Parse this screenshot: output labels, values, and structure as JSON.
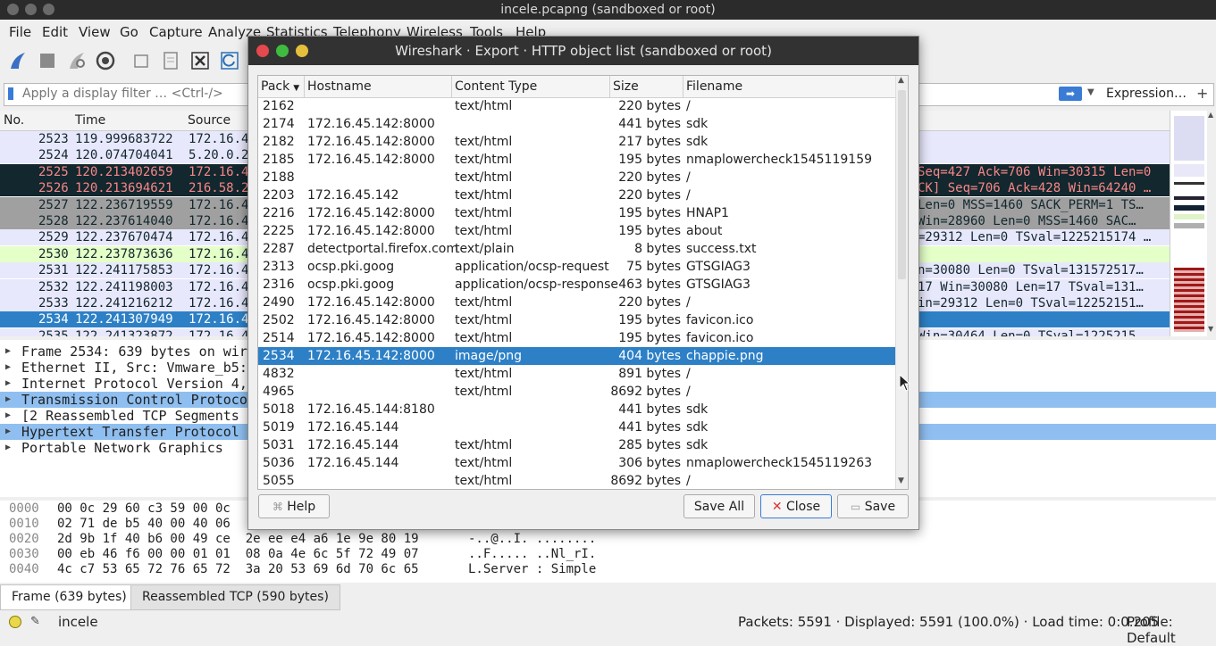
{
  "window": {
    "title": "incele.pcapng (sandboxed or root)"
  },
  "menu": [
    "File",
    "Edit",
    "View",
    "Go",
    "Capture",
    "Analyze",
    "Statistics",
    "Telephony",
    "Wireless",
    "Tools",
    "Help"
  ],
  "filter": {
    "placeholder": "Apply a display filter … <Ctrl-/>",
    "expression_label": "Expression…",
    "plus_label": "+"
  },
  "packet_list": {
    "columns": [
      "No.",
      "Time",
      "Source"
    ],
    "rows": [
      {
        "no": "2523",
        "time": "119.999683722",
        "source": "172.16.4",
        "info": "",
        "style": "lav"
      },
      {
        "no": "2524",
        "time": "120.074704041",
        "source": "5.20.0.2",
        "info": "",
        "style": "lav"
      },
      {
        "no": "2525",
        "time": "120.213402659",
        "source": "172.16.4",
        "info": "Seq=427 Ack=706 Win=30315 Len=0",
        "style": "darkred"
      },
      {
        "no": "2526",
        "time": "120.213694621",
        "source": "216.58.2",
        "info": "CK] Seq=706 Ack=428 Win=64240 …",
        "style": "darkred"
      },
      {
        "no": "2527",
        "time": "122.236719559",
        "source": "172.16.4",
        "info": "Len=0 MSS=1460 SACK_PERM=1 TS…",
        "style": "gray"
      },
      {
        "no": "2528",
        "time": "122.237614040",
        "source": "172.16.4",
        "info": " Win=28960 Len=0 MSS=1460 SAC…",
        "style": "gray"
      },
      {
        "no": "2529",
        "time": "122.237670474",
        "source": "172.16.4",
        "info": "=29312 Len=0 TSval=1225215174 …",
        "style": "lav"
      },
      {
        "no": "2530",
        "time": "122.237873636",
        "source": "172.16.4",
        "info": "",
        "style": "green"
      },
      {
        "no": "2531",
        "time": "122.241175853",
        "source": "172.16.4",
        "info": "n=30080 Len=0 TSval=131572517…",
        "style": "lav"
      },
      {
        "no": "2532",
        "time": "122.241198003",
        "source": "172.16.4",
        "info": "17 Win=30080 Len=17 TSval=131…",
        "style": "lav"
      },
      {
        "no": "2533",
        "time": "122.241216212",
        "source": "172.16.4",
        "info": "in=29312 Len=0 TSval=12252151…",
        "style": "lav"
      },
      {
        "no": "2534",
        "time": "122.241307949",
        "source": "172.16.4",
        "info": "",
        "style": "selected"
      },
      {
        "no": "2535",
        "time": "122.241323872",
        "source": "172.16.4",
        "info": "Win=30464 Len=0 TSval=1225215…",
        "style": "lav"
      }
    ]
  },
  "details": [
    {
      "text": "Frame 2534: 639 bytes on wir",
      "highlight": false
    },
    {
      "text": "Ethernet II, Src: Vmware_b5:",
      "highlight": false
    },
    {
      "text": "Internet Protocol Version 4,",
      "highlight": false
    },
    {
      "text": "Transmission Control Protoco",
      "highlight": true
    },
    {
      "text": "[2 Reassembled TCP Segments",
      "highlight": false
    },
    {
      "text": "Hypertext Transfer Protocol",
      "highlight": true
    },
    {
      "text": "Portable Network Graphics",
      "highlight": false
    }
  ],
  "bytes": [
    {
      "off": "0000",
      "hex": "00 0c 29 60 c3 59 00 0c",
      "ascii": ""
    },
    {
      "off": "0010",
      "hex": "02 71 de b5 40 00 40 06",
      "ascii": ""
    },
    {
      "off": "0020",
      "hex": "2d 9b 1f 40 b6 00 49 ce  2e ee e4 a6 1e 9e 80 19",
      "ascii": "-..@..I. ........"
    },
    {
      "off": "0030",
      "hex": "00 eb 46 f6 00 00 01 01  08 0a 4e 6c 5f 72 49 07",
      "ascii": "..F..... ..Nl_rI."
    },
    {
      "off": "0040",
      "hex": "4c c7 53 65 72 76 65 72  3a 20 53 69 6d 70 6c 65",
      "ascii": "L.Server : Simple"
    }
  ],
  "bottom_tabs": [
    "Frame (639 bytes)",
    "Reassembled TCP (590 bytes)"
  ],
  "status": {
    "profile_name": "incele",
    "packets": "Packets: 5591 · Displayed: 5591 (100.0%) · Load time: 0:0.205",
    "profile": "Profile: Default"
  },
  "dialog": {
    "title": "Wireshark · Export · HTTP object list (sandboxed or root)",
    "columns": [
      "Pack",
      "Hostname",
      "Content Type",
      "Size",
      "Filename"
    ],
    "rows": [
      {
        "pack": "2162",
        "host": "",
        "ctype": "text/html",
        "size": "220 bytes",
        "file": "/"
      },
      {
        "pack": "2174",
        "host": "172.16.45.142:8000",
        "ctype": "",
        "size": "441 bytes",
        "file": "sdk"
      },
      {
        "pack": "2182",
        "host": "172.16.45.142:8000",
        "ctype": "text/html",
        "size": "217 bytes",
        "file": "sdk"
      },
      {
        "pack": "2185",
        "host": "172.16.45.142:8000",
        "ctype": "text/html",
        "size": "195 bytes",
        "file": "nmaplowercheck1545119159"
      },
      {
        "pack": "2188",
        "host": "",
        "ctype": "text/html",
        "size": "220 bytes",
        "file": "/"
      },
      {
        "pack": "2203",
        "host": "172.16.45.142",
        "ctype": "text/html",
        "size": "220 bytes",
        "file": "/"
      },
      {
        "pack": "2216",
        "host": "172.16.45.142:8000",
        "ctype": "text/html",
        "size": "195 bytes",
        "file": "HNAP1"
      },
      {
        "pack": "2225",
        "host": "172.16.45.142:8000",
        "ctype": "text/html",
        "size": "195 bytes",
        "file": "about"
      },
      {
        "pack": "2287",
        "host": "detectportal.firefox.com",
        "ctype": "text/plain",
        "size": "8 bytes",
        "file": "success.txt"
      },
      {
        "pack": "2313",
        "host": "ocsp.pki.goog",
        "ctype": "application/ocsp-request",
        "size": "75 bytes",
        "file": "GTSGIAG3"
      },
      {
        "pack": "2316",
        "host": "ocsp.pki.goog",
        "ctype": "application/ocsp-response",
        "size": "463 bytes",
        "file": "GTSGIAG3"
      },
      {
        "pack": "2490",
        "host": "172.16.45.142:8000",
        "ctype": "text/html",
        "size": "220 bytes",
        "file": "/"
      },
      {
        "pack": "2502",
        "host": "172.16.45.142:8000",
        "ctype": "text/html",
        "size": "195 bytes",
        "file": "favicon.ico"
      },
      {
        "pack": "2514",
        "host": "172.16.45.142:8000",
        "ctype": "text/html",
        "size": "195 bytes",
        "file": "favicon.ico"
      },
      {
        "pack": "2534",
        "host": "172.16.45.142:8000",
        "ctype": "image/png",
        "size": "404 bytes",
        "file": "chappie.png",
        "selected": true
      },
      {
        "pack": "4832",
        "host": "",
        "ctype": "text/html",
        "size": "891 bytes",
        "file": "/"
      },
      {
        "pack": "4965",
        "host": "",
        "ctype": "text/html",
        "size": "8692 bytes",
        "file": "/"
      },
      {
        "pack": "5018",
        "host": "172.16.45.144:8180",
        "ctype": "",
        "size": "441 bytes",
        "file": "sdk"
      },
      {
        "pack": "5019",
        "host": "172.16.45.144",
        "ctype": "",
        "size": "441 bytes",
        "file": "sdk"
      },
      {
        "pack": "5031",
        "host": "172.16.45.144",
        "ctype": "text/html",
        "size": "285 bytes",
        "file": "sdk"
      },
      {
        "pack": "5036",
        "host": "172.16.45.144",
        "ctype": "text/html",
        "size": "306 bytes",
        "file": "nmaplowercheck1545119263"
      },
      {
        "pack": "5055",
        "host": "",
        "ctype": "text/html",
        "size": "8692 bytes",
        "file": "/"
      }
    ],
    "buttons": {
      "help": "Help",
      "save_all": "Save All",
      "close": "Close",
      "save": "Save"
    }
  }
}
